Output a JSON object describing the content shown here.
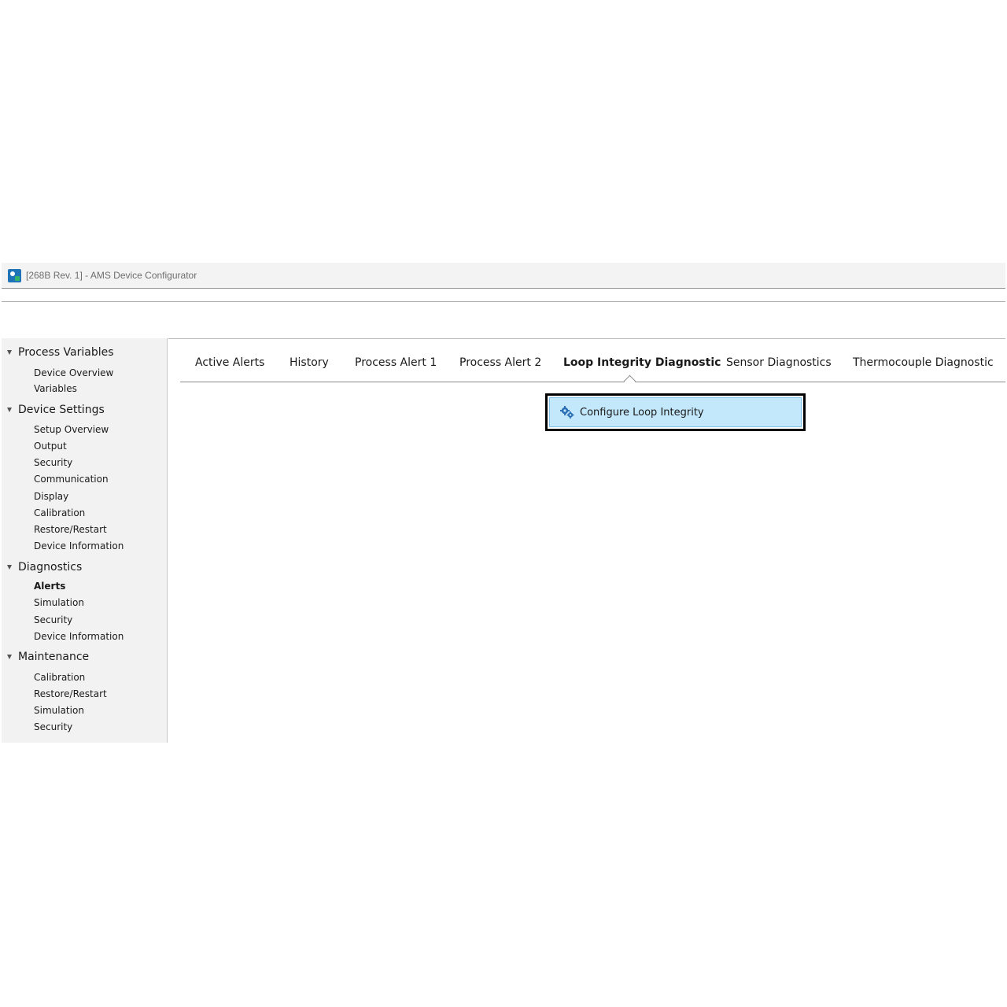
{
  "window": {
    "title": "[268B  Rev. 1] - AMS Device Configurator",
    "icon": "app-icon"
  },
  "sidebar": {
    "groups": [
      {
        "label": "Process Variables",
        "expanded": true,
        "items": [
          "Device Overview",
          "Variables"
        ]
      },
      {
        "label": "Device Settings",
        "expanded": true,
        "items": [
          "Setup Overview",
          "Output",
          "Security",
          "Communication",
          "Display",
          "Calibration",
          "Restore/Restart",
          "Device Information"
        ]
      },
      {
        "label": "Diagnostics",
        "expanded": true,
        "items": [
          "Alerts",
          "Simulation",
          "Security",
          "Device Information"
        ],
        "active_item": "Alerts"
      },
      {
        "label": "Maintenance",
        "expanded": true,
        "items": [
          "Calibration",
          "Restore/Restart",
          "Simulation",
          "Security"
        ]
      }
    ]
  },
  "tabs": {
    "items": [
      "Active Alerts",
      "History",
      "Process Alert 1",
      "Process Alert 2",
      "Loop Integrity Diagnostic",
      "Sensor Diagnostics",
      "Thermocouple Diagnostic"
    ],
    "active": "Loop Integrity Diagnostic"
  },
  "content": {
    "action_button": {
      "label": "Configure Loop Integrity",
      "icon": "gears-icon",
      "highlight_color": "#c3e7fb"
    }
  }
}
